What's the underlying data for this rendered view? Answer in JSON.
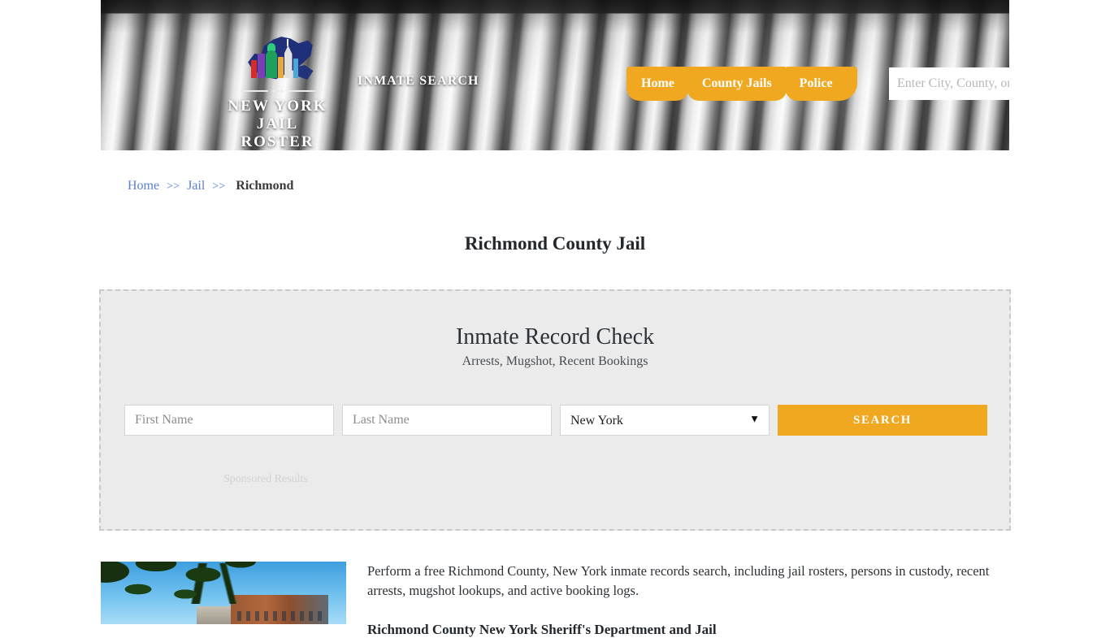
{
  "header": {
    "logo": {
      "line1": "NEW YORK",
      "line2": "JAIL ROSTER",
      "icon": "new-york-state-outline-with-buildings"
    },
    "tagline": "INMATE SEARCH",
    "nav": [
      {
        "label": "Home"
      },
      {
        "label": "County Jails"
      },
      {
        "label": "Police"
      }
    ],
    "search": {
      "placeholder": "Enter City, County, or Facility",
      "value": "",
      "button_icon": "search-icon"
    }
  },
  "breadcrumb": {
    "items": [
      {
        "label": "Home",
        "type": "link"
      },
      {
        "label": "Jail",
        "type": "link"
      },
      {
        "label": "Richmond",
        "type": "current"
      }
    ],
    "separator": ">>"
  },
  "page_title": "Richmond County Jail",
  "sponsored": {
    "title": "Inmate Record Check",
    "subtitle": "Arrests, Mugshot, Recent Bookings",
    "first_name": {
      "placeholder": "First Name",
      "value": ""
    },
    "last_name": {
      "placeholder": "Last Name",
      "value": ""
    },
    "state": {
      "selected": "New York",
      "caret_icon": "chevron-down-icon"
    },
    "search_button": "SEARCH",
    "note": "Sponsored Results",
    "accent_color": "#efa81f",
    "panel_bg": "#ebebeb"
  },
  "article": {
    "thumbnail_alt": "Richmond County jail building under blue sky with tree branches",
    "paragraph": "Perform a free Richmond County, New York inmate records search, including jail rosters, persons in custody, recent arrests, mugshot lookups, and active booking logs.",
    "heading": "Richmond County New York Sheriff's Department and Jail"
  }
}
